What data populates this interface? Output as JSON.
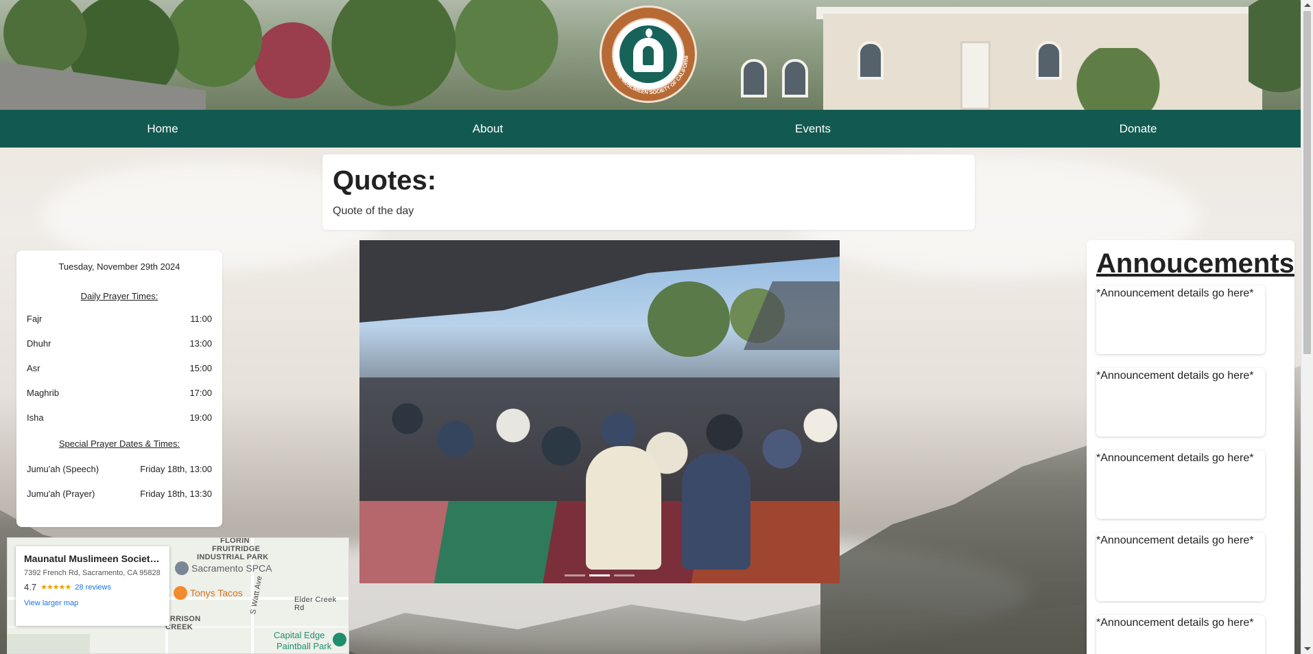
{
  "header": {
    "logo": {
      "established": "ESTD. 2011",
      "org_name_ring": "MAUNATUL MUSLIMEEN SOCIETY OF CALIFORNIA"
    }
  },
  "nav": {
    "items": [
      {
        "label": "Home"
      },
      {
        "label": "About"
      },
      {
        "label": "Events"
      },
      {
        "label": "Donate"
      }
    ]
  },
  "quotes": {
    "title": "Quotes:",
    "text": "Quote of the day"
  },
  "prayer": {
    "date": "Tuesday, November 29th 2024",
    "daily_title": "Daily Prayer Times:",
    "daily": [
      {
        "name": "Fajr",
        "time": "11:00"
      },
      {
        "name": "Dhuhr",
        "time": "13:00"
      },
      {
        "name": "Asr",
        "time": "15:00"
      },
      {
        "name": "Maghrib",
        "time": "17:00"
      },
      {
        "name": "Isha",
        "time": "19:00"
      }
    ],
    "special_title": "Special Prayer Dates & Times:",
    "special": [
      {
        "name": "Jumu'ah (Speech)",
        "time": "Friday 18th, 13:00"
      },
      {
        "name": "Jumu'ah (Prayer)",
        "time": "Friday 18th, 13:30"
      }
    ]
  },
  "map": {
    "card": {
      "name": "Maunatul Muslimeen Society ...",
      "address": "7392 French Rd, Sacramento, CA 95828",
      "rating": "4.7",
      "stars": "★★★★★",
      "reviews": "28 reviews",
      "larger_map": "View larger map"
    },
    "labels": {
      "area1": "FLORIN",
      "area2": "FRUITRIDGE",
      "area3": "INDUSTRIAL PARK",
      "poi1": "Sacramento SPCA",
      "poi2": "Tonys Tacos",
      "road1": "Elder Creek Rd",
      "area4": "ORRISON",
      "area5": "CREEK",
      "road2": "S Watt Ave",
      "poi3": "Capital Edge",
      "poi3b": "Paintball Park"
    }
  },
  "carousel": {
    "slide_count": 3,
    "active_index": 1
  },
  "announcements": {
    "title": "Annoucements",
    "items": [
      {
        "text": "*Announcement details go here*"
      },
      {
        "text": "*Announcement details go here*"
      },
      {
        "text": "*Announcement details go here*"
      },
      {
        "text": "*Announcement details go here*"
      },
      {
        "text": "*Announcement details go here*"
      }
    ]
  },
  "colors": {
    "nav_bg": "#125a51",
    "logo_ring": "#b86a35",
    "logo_core": "#17635a",
    "link": "#1a73e8",
    "star": "#e8a200"
  }
}
